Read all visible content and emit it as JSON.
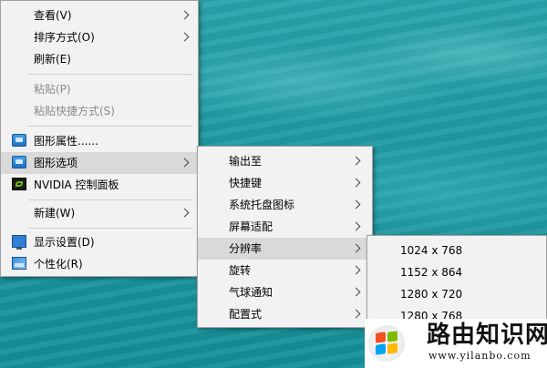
{
  "context_menu": {
    "items": [
      {
        "label": "查看(V)"
      },
      {
        "label": "排序方式(O)"
      },
      {
        "label": "刷新(E)"
      },
      {
        "label": "粘贴(P)"
      },
      {
        "label": "粘贴快捷方式(S)"
      },
      {
        "label": "图形属性......"
      },
      {
        "label": "图形选项"
      },
      {
        "label": "NVIDIA 控制面板"
      },
      {
        "label": "新建(W)"
      },
      {
        "label": "显示设置(D)"
      },
      {
        "label": "个性化(R)"
      }
    ]
  },
  "graphics_submenu": {
    "items": [
      {
        "label": "输出至"
      },
      {
        "label": "快捷键"
      },
      {
        "label": "系统托盘图标"
      },
      {
        "label": "屏幕适配"
      },
      {
        "label": "分辨率"
      },
      {
        "label": "旋转"
      },
      {
        "label": "气球通知"
      },
      {
        "label": "配置式"
      }
    ]
  },
  "resolution_submenu": {
    "items": [
      {
        "label": "1024 x 768"
      },
      {
        "label": "1152 x 864"
      },
      {
        "label": "1280 x 720"
      },
      {
        "label": "1280 x 768"
      }
    ]
  },
  "watermark": {
    "brand": "路由知识网",
    "url": "www.yilanbo.com"
  }
}
